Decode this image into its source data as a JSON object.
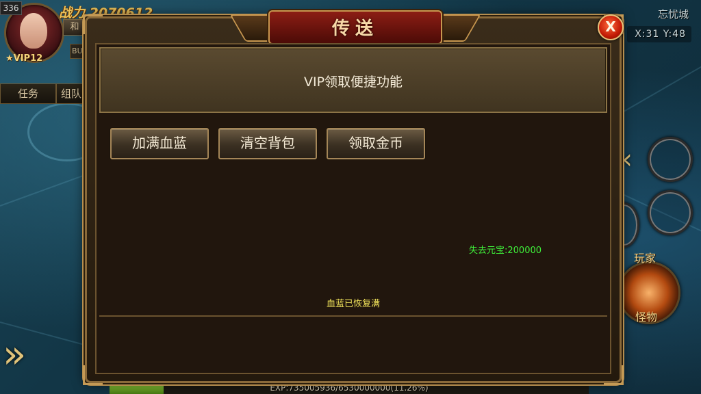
{
  "hud": {
    "level": "336",
    "power_label": "战力",
    "power_value": "2070612",
    "vip": "VIP12",
    "small_button": "和",
    "buff_button": "BUF",
    "tabs": [
      "任务",
      "组队"
    ]
  },
  "minimap": {
    "map_name": "忘忧城",
    "coords": "X:31 Y:48"
  },
  "actions": {
    "player_label": "玩家",
    "monster_label": "怪物"
  },
  "exp": {
    "text": "EXP:735005936/6530000000(11.26%)",
    "percent": 11.26
  },
  "dialog": {
    "title": "传送",
    "close_label": "X",
    "header": "VIP领取便捷功能",
    "buttons": [
      "加满血蓝",
      "清空背包",
      "领取金币"
    ],
    "lost_text": "失去元宝:200000",
    "status_text": "血蓝已恢复满"
  }
}
